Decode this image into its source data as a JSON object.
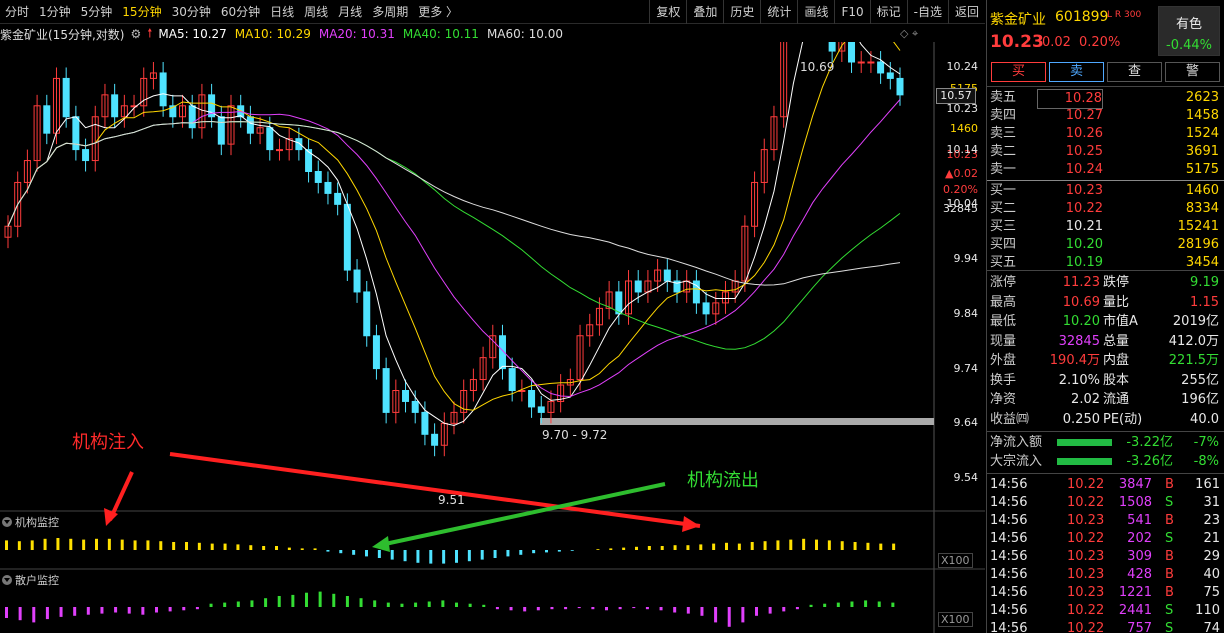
{
  "toolbar": {
    "periods": [
      "分时",
      "1分钟",
      "5分钟",
      "15分钟",
      "30分钟",
      "60分钟",
      "日线",
      "周线",
      "月线",
      "多周期",
      "更多 〉"
    ],
    "active_period": "15分钟",
    "right_buttons": [
      "复权",
      "叠加",
      "历史",
      "统计",
      "画线",
      "F10",
      "标记",
      "-自选",
      "返回"
    ]
  },
  "chart_header": {
    "title": "紫金矿业(15分钟,对数)",
    "ma": [
      {
        "label": "MA5: 10.27",
        "color": "#ffffff"
      },
      {
        "label": "MA10: 10.29",
        "color": "#ffd700"
      },
      {
        "label": "MA20: 10.31",
        "color": "#e040fb"
      },
      {
        "label": "MA40: 10.11",
        "color": "#33dd33"
      },
      {
        "label": "MA60: 10.00",
        "color": "#dddddd"
      }
    ]
  },
  "y_axis": {
    "ticks": [
      "10.24",
      "10.14",
      "10.04",
      "9.94",
      "9.84",
      "9.74",
      "9.64",
      "9.54"
    ],
    "current_price_tag": "10.57",
    "top_labels": [
      "10.24",
      "5175",
      "10.23",
      "1460",
      "10.23",
      "▲0.02",
      "0.20%",
      "32845"
    ]
  },
  "annotations": {
    "high": "10.69",
    "low": "9.51",
    "range": "9.70 - 9.72",
    "inflow_text": "机构注入",
    "outflow_text": "机构流出"
  },
  "subcharts": {
    "inst_title": "机构监控",
    "retail_title": "散户监控",
    "scale": "X100"
  },
  "chart_data": {
    "type": "candlestick",
    "title": "紫金矿业(15分钟,对数)",
    "high_label": 10.69,
    "low_label": 9.51,
    "ylim": [
      9.5,
      10.3
    ],
    "y_ticks": [
      10.24,
      10.14,
      10.04,
      9.94,
      9.84,
      9.74,
      9.64,
      9.54
    ],
    "close": [
      10.0,
      10.08,
      10.12,
      10.22,
      10.17,
      10.27,
      10.2,
      10.14,
      10.12,
      10.2,
      10.24,
      10.2,
      10.22,
      10.22,
      10.27,
      10.28,
      10.22,
      10.2,
      10.22,
      10.18,
      10.24,
      10.2,
      10.15,
      10.22,
      10.2,
      10.17,
      10.18,
      10.14,
      10.14,
      10.16,
      10.14,
      10.1,
      10.08,
      10.06,
      10.04,
      9.92,
      9.88,
      9.8,
      9.74,
      9.66,
      9.7,
      9.68,
      9.66,
      9.62,
      9.6,
      9.64,
      9.66,
      9.7,
      9.72,
      9.76,
      9.8,
      9.74,
      9.7,
      9.7,
      9.67,
      9.66,
      9.68,
      9.71,
      9.72,
      9.8,
      9.82,
      9.85,
      9.88,
      9.84,
      9.9,
      9.88,
      9.9,
      9.92,
      9.9,
      9.88,
      9.9,
      9.86,
      9.84,
      9.86,
      9.88,
      9.9,
      10.0,
      10.08,
      10.14,
      10.2,
      10.36,
      10.52,
      10.48,
      10.46,
      10.4,
      10.32,
      10.34,
      10.3,
      10.3,
      10.3,
      10.28,
      10.27,
      10.24
    ],
    "inst_values": [
      12,
      11,
      12,
      14,
      15,
      14,
      13,
      14,
      14,
      13,
      12,
      12,
      11,
      10,
      10,
      9,
      8,
      8,
      7,
      6,
      5,
      5,
      3,
      2,
      2,
      -2,
      -4,
      -6,
      -8,
      -10,
      -12,
      -14,
      -16,
      -17,
      -17,
      -16,
      -14,
      -12,
      -10,
      -8,
      -6,
      -4,
      -3,
      -2,
      -1,
      0,
      1,
      2,
      3,
      4,
      5,
      5,
      6,
      6,
      7,
      8,
      9,
      8,
      10,
      11,
      12,
      13,
      14,
      13,
      12,
      11,
      10,
      9,
      8,
      8
    ],
    "retail_values": [
      -10,
      -12,
      -14,
      -11,
      -9,
      -8,
      -7,
      -6,
      -5,
      -6,
      -7,
      -5,
      -4,
      -3,
      -2,
      3,
      4,
      5,
      6,
      8,
      10,
      11,
      13,
      14,
      12,
      10,
      8,
      6,
      4,
      3,
      4,
      5,
      6,
      4,
      3,
      2,
      -2,
      -3,
      -4,
      -3,
      -2,
      -2,
      -1,
      -2,
      -3,
      -2,
      -1,
      -2,
      -3,
      -5,
      -6,
      -8,
      -14,
      -18,
      -14,
      -8,
      -6,
      -4,
      -2,
      2,
      3,
      4,
      5,
      6,
      5,
      4
    ],
    "series": [
      {
        "name": "MA5"
      },
      {
        "name": "MA10"
      },
      {
        "name": "MA20"
      },
      {
        "name": "MA40"
      },
      {
        "name": "MA60"
      }
    ]
  },
  "stock": {
    "name": "紫金矿业",
    "code": "601899",
    "tag": "L R 300",
    "sector": "有色",
    "sector_change": "-0.44%",
    "price": "10.23",
    "change": "0.02",
    "pct": "0.20%"
  },
  "actions": [
    "买",
    "卖",
    "查",
    "警"
  ],
  "asks": [
    {
      "label": "卖五",
      "price": "10.28",
      "vol": "2623"
    },
    {
      "label": "卖四",
      "price": "10.27",
      "vol": "1458"
    },
    {
      "label": "卖三",
      "price": "10.26",
      "vol": "1524"
    },
    {
      "label": "卖二",
      "price": "10.25",
      "vol": "3691"
    },
    {
      "label": "卖一",
      "price": "10.24",
      "vol": "5175"
    }
  ],
  "bids": [
    {
      "label": "买一",
      "price": "10.23",
      "vol": "1460"
    },
    {
      "label": "买二",
      "price": "10.22",
      "vol": "8334"
    },
    {
      "label": "买三",
      "price": "10.21",
      "vol": "15241"
    },
    {
      "label": "买四",
      "price": "10.20",
      "vol": "28196"
    },
    {
      "label": "买五",
      "price": "10.19",
      "vol": "3454"
    }
  ],
  "stats": [
    {
      "k1": "涨停",
      "v1": "11.23",
      "k2": "跌停",
      "v2": "9.19"
    },
    {
      "k1": "最高",
      "v1": "10.69",
      "k2": "量比",
      "v2": "1.15"
    },
    {
      "k1": "最低",
      "v1": "10.20",
      "k2": "市值A",
      "v2": "2019亿"
    },
    {
      "k1": "现量",
      "v1": "32845",
      "k2": "总量",
      "v2": "412.0万"
    },
    {
      "k1": "外盘",
      "v1": "190.4万",
      "k2": "内盘",
      "v2": "221.5万"
    },
    {
      "k1": "换手",
      "v1": "2.10%",
      "k2": "股本",
      "v2": "255亿"
    },
    {
      "k1": "净资",
      "v1": "2.02",
      "k2": "流通",
      "v2": "196亿"
    },
    {
      "k1": "收益㈣",
      "v1": "0.250",
      "k2": "PE(动)",
      "v2": "40.0"
    }
  ],
  "flows": [
    {
      "label": "净流入额",
      "value": "-3.22亿",
      "pct": "-7%"
    },
    {
      "label": "大宗流入",
      "value": "-3.26亿",
      "pct": "-8%"
    }
  ],
  "ticks": [
    {
      "time": "14:56",
      "price": "10.22",
      "vol": "3847",
      "side": "B",
      "n": "161"
    },
    {
      "time": "14:56",
      "price": "10.22",
      "vol": "1508",
      "side": "S",
      "n": "31"
    },
    {
      "time": "14:56",
      "price": "10.23",
      "vol": "541",
      "side": "B",
      "n": "23"
    },
    {
      "time": "14:56",
      "price": "10.22",
      "vol": "202",
      "side": "S",
      "n": "21"
    },
    {
      "time": "14:56",
      "price": "10.23",
      "vol": "309",
      "side": "B",
      "n": "29"
    },
    {
      "time": "14:56",
      "price": "10.23",
      "vol": "428",
      "side": "B",
      "n": "40"
    },
    {
      "time": "14:56",
      "price": "10.23",
      "vol": "1221",
      "side": "B",
      "n": "75"
    },
    {
      "time": "14:56",
      "price": "10.22",
      "vol": "2441",
      "side": "S",
      "n": "110"
    },
    {
      "time": "14:56",
      "price": "10.22",
      "vol": "757",
      "side": "S",
      "n": "74"
    }
  ]
}
